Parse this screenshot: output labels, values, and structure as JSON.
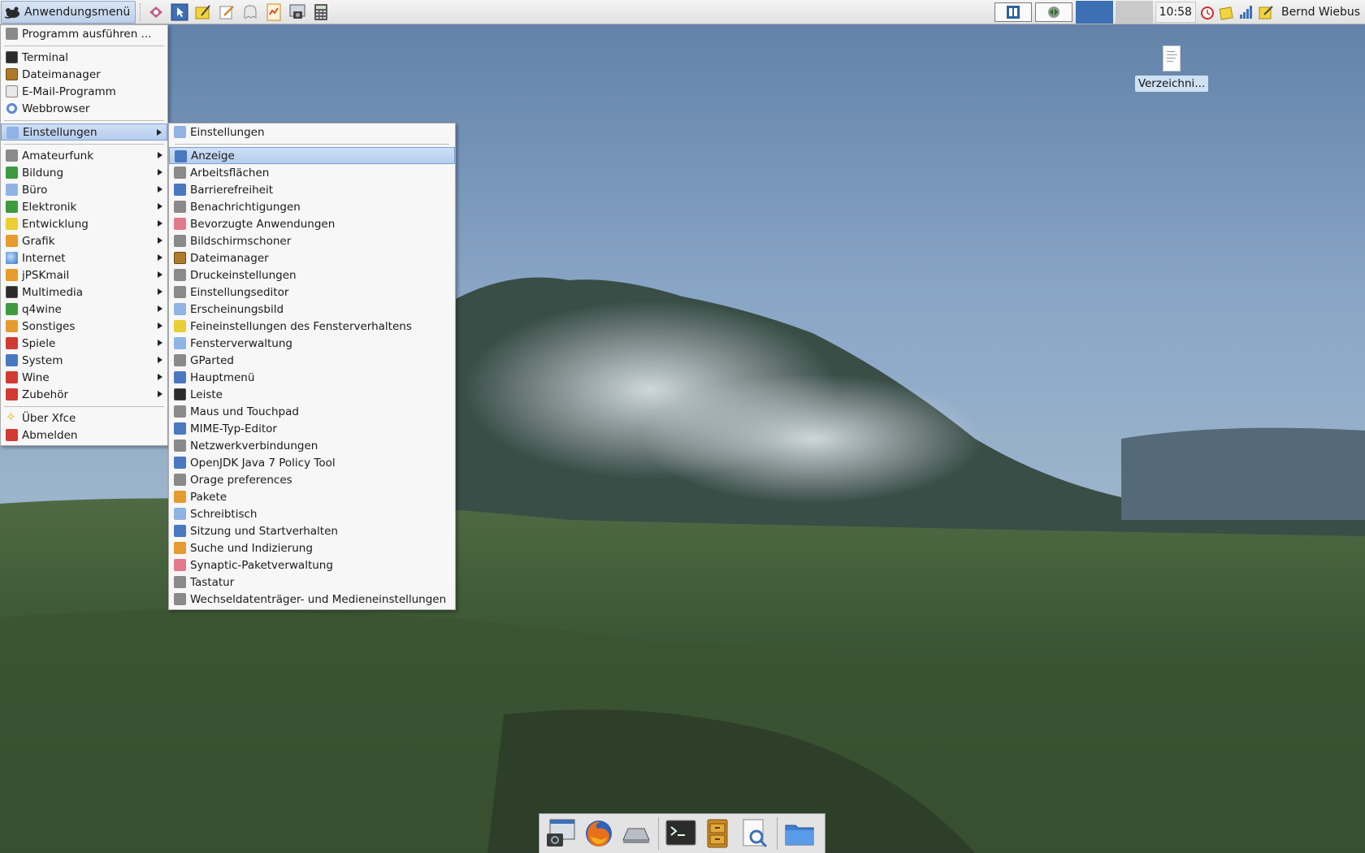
{
  "top_panel": {
    "app_menu_label": "Anwendungsmenü",
    "launchers": [
      "kcolorchooser-icon",
      "pointer-select-icon",
      "notes-icon",
      "edit-icon",
      "ghost-icon",
      "spreadsheet-icon",
      "screenshot-icon",
      "calculator-icon"
    ],
    "clock": "10:58",
    "user_name": "Bernd Wiebus"
  },
  "main_menu": {
    "items": [
      {
        "label": "Programm ausführen ...",
        "icon": "run-icon"
      },
      {
        "separator": true
      },
      {
        "label": "Terminal",
        "icon": "terminal-icon"
      },
      {
        "label": "Dateimanager",
        "icon": "file-manager-icon"
      },
      {
        "label": "E-Mail-Programm",
        "icon": "mail-icon"
      },
      {
        "label": "Webbrowser",
        "icon": "web-browser-icon"
      },
      {
        "separator": true
      },
      {
        "label": "Einstellungen",
        "icon": "settings-icon",
        "submenu": true,
        "highlighted": true
      },
      {
        "separator": true
      },
      {
        "label": "Amateurfunk",
        "icon": "radio-icon",
        "submenu": true
      },
      {
        "label": "Bildung",
        "icon": "education-icon",
        "submenu": true
      },
      {
        "label": "Büro",
        "icon": "office-icon",
        "submenu": true
      },
      {
        "label": "Elektronik",
        "icon": "electronics-icon",
        "submenu": true
      },
      {
        "label": "Entwicklung",
        "icon": "development-icon",
        "submenu": true
      },
      {
        "label": "Grafik",
        "icon": "graphics-icon",
        "submenu": true
      },
      {
        "label": "Internet",
        "icon": "internet-icon",
        "submenu": true
      },
      {
        "label": "jPSKmail",
        "icon": "jpskmail-icon",
        "submenu": true
      },
      {
        "label": "Multimedia",
        "icon": "multimedia-icon",
        "submenu": true
      },
      {
        "label": "q4wine",
        "icon": "q4wine-icon",
        "submenu": true
      },
      {
        "label": "Sonstiges",
        "icon": "misc-icon",
        "submenu": true
      },
      {
        "label": "Spiele",
        "icon": "games-icon",
        "submenu": true
      },
      {
        "label": "System",
        "icon": "system-icon",
        "submenu": true
      },
      {
        "label": "Wine",
        "icon": "wine-icon",
        "submenu": true
      },
      {
        "label": "Zubehör",
        "icon": "accessories-icon",
        "submenu": true
      },
      {
        "separator": true
      },
      {
        "label": "Über Xfce",
        "icon": "about-xfce-icon"
      },
      {
        "label": "Abmelden",
        "icon": "logout-icon"
      }
    ]
  },
  "sub_menu": {
    "items": [
      {
        "label": "Einstellungen",
        "icon": "settings-manager-icon"
      },
      {
        "separator": true
      },
      {
        "label": "Anzeige",
        "icon": "display-icon",
        "highlighted": true
      },
      {
        "label": "Arbeitsflächen",
        "icon": "workspaces-icon"
      },
      {
        "label": "Barrierefreiheit",
        "icon": "accessibility-icon"
      },
      {
        "label": "Benachrichtigungen",
        "icon": "notifications-icon"
      },
      {
        "label": "Bevorzugte Anwendungen",
        "icon": "preferred-apps-icon"
      },
      {
        "label": "Bildschirmschoner",
        "icon": "screensaver-icon"
      },
      {
        "label": "Dateimanager",
        "icon": "file-manager-icon"
      },
      {
        "label": "Druckeinstellungen",
        "icon": "printer-icon"
      },
      {
        "label": "Einstellungseditor",
        "icon": "settings-editor-icon"
      },
      {
        "label": "Erscheinungsbild",
        "icon": "appearance-icon"
      },
      {
        "label": "Feineinstellungen des Fensterverhaltens",
        "icon": "window-tweaks-icon"
      },
      {
        "label": "Fensterverwaltung",
        "icon": "window-manager-icon"
      },
      {
        "label": "GParted",
        "icon": "gparted-icon"
      },
      {
        "label": "Hauptmenü",
        "icon": "main-menu-icon"
      },
      {
        "label": "Leiste",
        "icon": "panel-icon"
      },
      {
        "label": "Maus und Touchpad",
        "icon": "mouse-icon"
      },
      {
        "label": "MIME-Typ-Editor",
        "icon": "mime-editor-icon"
      },
      {
        "label": "Netzwerkverbindungen",
        "icon": "network-icon"
      },
      {
        "label": "OpenJDK Java 7 Policy Tool",
        "icon": "java-icon"
      },
      {
        "label": "Orage preferences",
        "icon": "calendar-icon"
      },
      {
        "label": "Pakete",
        "icon": "packages-icon"
      },
      {
        "label": "Schreibtisch",
        "icon": "desktop-icon"
      },
      {
        "label": "Sitzung und Startverhalten",
        "icon": "session-icon"
      },
      {
        "label": "Suche und Indizierung",
        "icon": "search-index-icon"
      },
      {
        "label": "Synaptic-Paketverwaltung",
        "icon": "synaptic-icon"
      },
      {
        "label": "Tastatur",
        "icon": "keyboard-icon"
      },
      {
        "label": "Wechseldatenträger- und Medieneinstellungen",
        "icon": "removable-media-icon"
      }
    ]
  },
  "desktop": {
    "file_label": "Verzeichni..."
  },
  "dock": {
    "items": [
      "screenshot-icon",
      "firefox-icon",
      "network-drive-icon",
      "terminal-icon",
      "file-cabinet-icon",
      "app-finder-icon",
      "folder-icon"
    ]
  }
}
